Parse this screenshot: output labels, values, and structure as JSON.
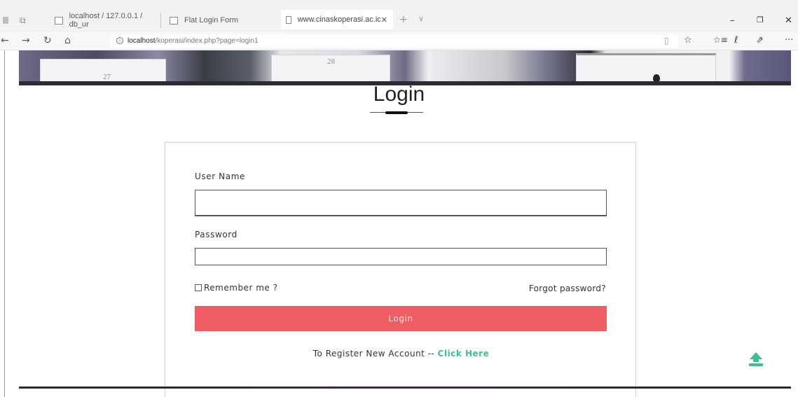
{
  "browser": {
    "tabs": [
      {
        "label": "localhost / 127.0.0.1 / db_ur",
        "active": false
      },
      {
        "label": "Flat Login Form",
        "active": false
      },
      {
        "label": "www.cinaskoperasi.ac.ic",
        "active": true
      }
    ],
    "tab_close": "✕",
    "new_tab": "+",
    "tab_menu": "∨",
    "url_host": "localhost",
    "url_path": "/koperasi/index.php?page=login1",
    "icons": [
      "back-arrow-icon",
      "forward-arrow-icon",
      "refresh-icon",
      "home-icon",
      "info-icon",
      "reading-view-icon",
      "star-icon",
      "favorites-icon",
      "notes-icon",
      "share-icon",
      "more-icon"
    ]
  },
  "hero": {
    "numbers": [
      "27",
      "28"
    ]
  },
  "page": {
    "title": "Login"
  },
  "form": {
    "username_label": "User Name",
    "username_value": "",
    "password_label": "Password",
    "password_value": "",
    "remember_label": "Remember me ?",
    "forgot_label": "Forgot password?",
    "login_button": "Login",
    "register_text": "To Register New Account -- ",
    "register_link": "Click Here"
  },
  "colors": {
    "login_button": "#ef5d63",
    "register_link": "#3fc08d",
    "scroll_top_icon": "#3fc08d"
  }
}
